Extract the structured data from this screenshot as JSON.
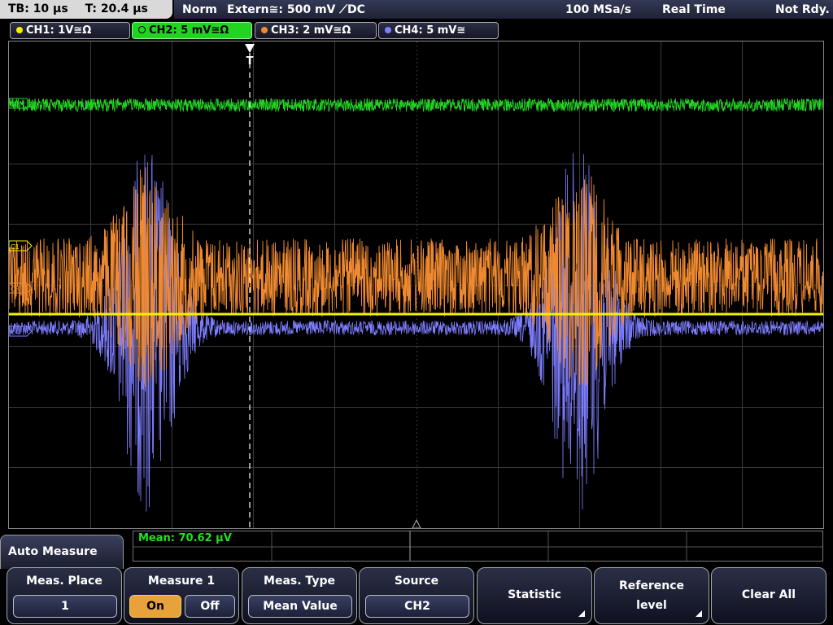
{
  "status": {
    "timebase": "TB: 10 µs",
    "trigger_time": "T: 20.4 µs",
    "mode": "Norm",
    "trigger_source": "Extern≅: 500 mV ⟋DC",
    "sample_rate": "100 MSa/s",
    "acq_mode": "Real Time",
    "ready_state": "Not Rdy."
  },
  "channels": [
    {
      "label": "CH1: 1V≅Ω",
      "color": "#f2f200",
      "active": false
    },
    {
      "label": "CH2: 5 mV≅Ω",
      "color": "#22d322",
      "active": true
    },
    {
      "label": "CH3: 2 mV≅Ω",
      "color": "#f08a30",
      "active": false
    },
    {
      "label": "CH4: 5 mV≅",
      "color": "#7d7dff",
      "active": false
    }
  ],
  "markers": {
    "ch1": "C1",
    "ch2": "C2",
    "ch3": "C3",
    "ch4": "C4",
    "trigger": "T"
  },
  "colors": {
    "ch1": "#f2f200",
    "ch2": "#22d322",
    "ch3": "#f08a30",
    "ch4": "#7d7dff",
    "grid": "#3a3a3a",
    "accent_on": "#e8a23c"
  },
  "measurement": {
    "readout": "Mean: 70.62 µV"
  },
  "menu": {
    "title": "Auto Measure",
    "softkeys": {
      "meas_place_label": "Meas. Place",
      "meas_place_value": "1",
      "measure_label": "Measure 1",
      "on_label": "On",
      "off_label": "Off",
      "meas_type_label": "Meas. Type",
      "meas_type_value": "Mean Value",
      "source_label": "Source",
      "source_value": "CH2",
      "statistic_label": "Statistic",
      "reference_label_1": "Reference",
      "reference_label_2": "level",
      "clear_all_label": "Clear All"
    }
  }
}
